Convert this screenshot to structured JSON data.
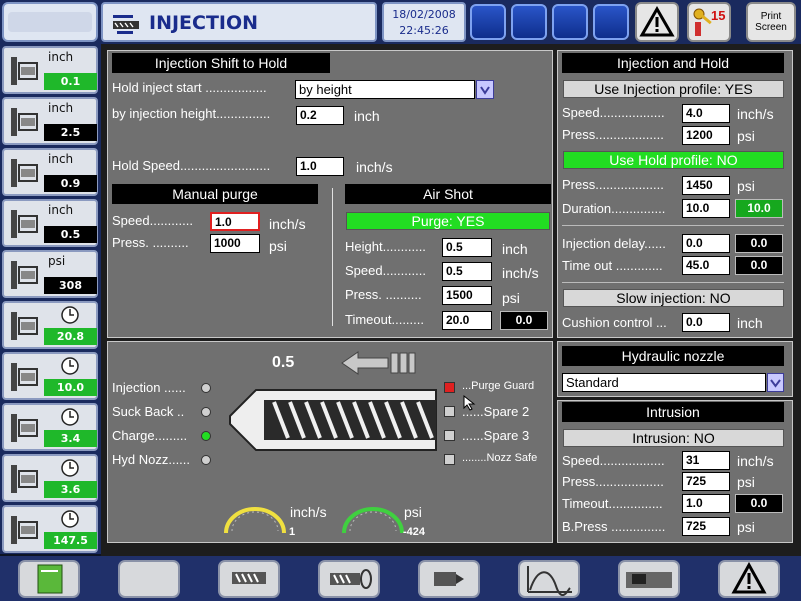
{
  "header": {
    "title": "INJECTION",
    "date": "18/02/2008",
    "time": "22:45:26",
    "key_count": "15",
    "print_label_1": "Print",
    "print_label_2": "Screen"
  },
  "sidebar": [
    {
      "unit": "inch",
      "value": "0.1",
      "style": "g",
      "icon": "clamp-open-icon"
    },
    {
      "unit": "inch",
      "value": "2.5",
      "style": "b",
      "icon": "ejector-icon"
    },
    {
      "unit": "inch",
      "value": "0.9",
      "style": "b",
      "icon": "core-pull-icon"
    },
    {
      "unit": "inch",
      "value": "0.5",
      "style": "b",
      "icon": "injection-screw-icon"
    },
    {
      "unit": "psi",
      "value": "308",
      "style": "b",
      "icon": "pressure-gauge-icon"
    },
    {
      "unit": "",
      "value": "20.8",
      "style": "g",
      "icon": "injection-time-icon"
    },
    {
      "unit": "",
      "value": "10.0",
      "style": "g",
      "icon": "hold-time-icon"
    },
    {
      "unit": "",
      "value": "3.4",
      "style": "g",
      "icon": "charge-time-icon"
    },
    {
      "unit": "",
      "value": "3.6",
      "style": "g",
      "icon": "cooling-time-icon"
    },
    {
      "unit": "",
      "value": "147.5",
      "style": "g",
      "icon": "cycle-time-icon"
    }
  ],
  "shift": {
    "header": "Injection Shift  to Hold",
    "start_label": "Hold inject start .................",
    "start_value": "by height",
    "height_label": "by injection height...............",
    "height_value": "0.2",
    "height_unit": "inch",
    "speed_label": "Hold Speed.........................",
    "speed_value": "1.0",
    "speed_unit": "inch/s"
  },
  "purge": {
    "header": "Manual purge",
    "speed_label": "Speed............",
    "speed_value": "1.0",
    "speed_unit": "inch/s",
    "press_label": "Press. ..........",
    "press_value": "1000",
    "press_unit": "psi"
  },
  "airshot": {
    "header": "Air Shot",
    "status": "Purge: YES",
    "height_label": "Height............",
    "height_value": "0.5",
    "height_unit": "inch",
    "speed_label": "Speed............",
    "speed_value": "0.5",
    "speed_unit": "inch/s",
    "press_label": "Press. ..........",
    "press_value": "1500",
    "press_unit": "psi",
    "timeout_label": "Timeout.........",
    "timeout_value": "20.0",
    "timeout_actual": "0.0"
  },
  "diagram": {
    "position": "0.5",
    "left_labels": [
      "Injection ......",
      "Suck Back ..",
      "Charge.........",
      "Hyd Nozz......"
    ],
    "right_labels": [
      "...Purge Guard",
      "......Spare 2",
      "......Spare 3",
      "........Nozz Safe"
    ],
    "speed_unit": "inch/s",
    "speed_value": "1",
    "press_unit": "psi",
    "press_value": "-424"
  },
  "injhold": {
    "header": "Injection and Hold",
    "inj_profile": "Use Injection profile: YES",
    "speed_label": "Speed..................",
    "speed_value": "4.0",
    "speed_unit": "inch/s",
    "press_label": "Press...................",
    "press_value": "1200",
    "press_unit": "psi",
    "hold_profile": "Use Hold profile: NO",
    "hpress_label": "Press...................",
    "hpress_value": "1450",
    "hpress_unit": "psi",
    "duration_label": "Duration...............",
    "duration_value": "10.0",
    "duration_actual": "10.0",
    "delay_label": "Injection delay......",
    "delay_value": "0.0",
    "delay_actual": "0.0",
    "timeout_label": "Time out .............",
    "timeout_value": "45.0",
    "timeout_actual": "0.0",
    "slow": "Slow injection: NO",
    "cushion_label": "Cushion control ...",
    "cushion_value": "0.0",
    "cushion_unit": "inch"
  },
  "nozzle": {
    "header": "Hydraulic nozzle",
    "value": "Standard"
  },
  "intrusion": {
    "header": "Intrusion",
    "status": "Intrusion: NO",
    "speed_label": "Speed..................",
    "speed_value": "31",
    "speed_unit": "inch/s",
    "press_label": "Press...................",
    "press_value": "725",
    "press_unit": "psi",
    "timeout_label": "Timeout...............",
    "timeout_value": "1.0",
    "timeout_actual": "0.0",
    "bpress_label": "B.Press ...............",
    "bpress_value": "725",
    "bpress_unit": "psi"
  },
  "colors": {
    "accent_green": "#22dd22",
    "alarm_red": "#e02020",
    "title_blue": "#1a2c8c"
  }
}
